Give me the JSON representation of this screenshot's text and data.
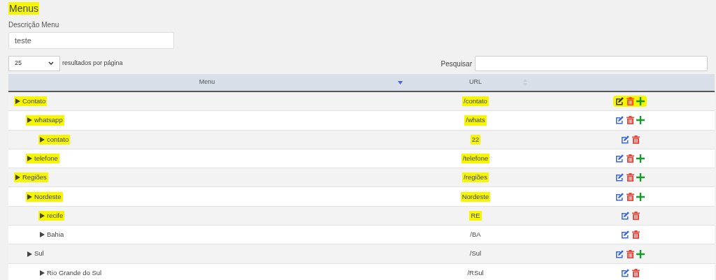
{
  "title": {
    "text": "Menus",
    "highlighted": true
  },
  "description": {
    "label": "Descrição Menu",
    "value": "teste"
  },
  "page_size": {
    "value": "25",
    "label": "resultados por página"
  },
  "search": {
    "label": "Pesquisar"
  },
  "table": {
    "columns": [
      {
        "label": "Menu",
        "sorted": true
      },
      {
        "label": "URL",
        "sorted": false
      }
    ],
    "rows": [
      {
        "menu": "Contato",
        "url": "/contato",
        "highlighted": true,
        "actions_highlighted": true,
        "can_add": true,
        "children": [
          {
            "menu": "whatsapp",
            "url": "/whats",
            "highlighted": true,
            "actions_highlighted": false,
            "can_add": true,
            "children": [
              {
                "menu": "contato",
                "url": "22",
                "highlighted": true,
                "actions_highlighted": false,
                "can_add": false
              }
            ]
          },
          {
            "menu": "telefone",
            "url": "/telefone",
            "highlighted": true,
            "actions_highlighted": false,
            "can_add": true
          }
        ]
      },
      {
        "menu": "Regiões",
        "url": "/regiões",
        "highlighted": true,
        "actions_highlighted": false,
        "can_add": true,
        "children": [
          {
            "menu": "Nordeste",
            "url": "Nordeste",
            "highlighted": true,
            "actions_highlighted": false,
            "can_add": true,
            "children": [
              {
                "menu": "recife",
                "url": "RE",
                "highlighted": true,
                "actions_highlighted": false,
                "can_add": false
              },
              {
                "menu": "Bahia",
                "url": "/BA",
                "highlighted": false,
                "actions_highlighted": false,
                "can_add": false
              }
            ]
          },
          {
            "menu": "Sul",
            "url": "/Sul",
            "highlighted": false,
            "actions_highlighted": false,
            "can_add": true,
            "children": [
              {
                "menu": "Rio Grande do Sul",
                "url": "/RSul",
                "highlighted": false,
                "actions_highlighted": false,
                "can_add": false
              }
            ]
          }
        ]
      }
    ]
  }
}
